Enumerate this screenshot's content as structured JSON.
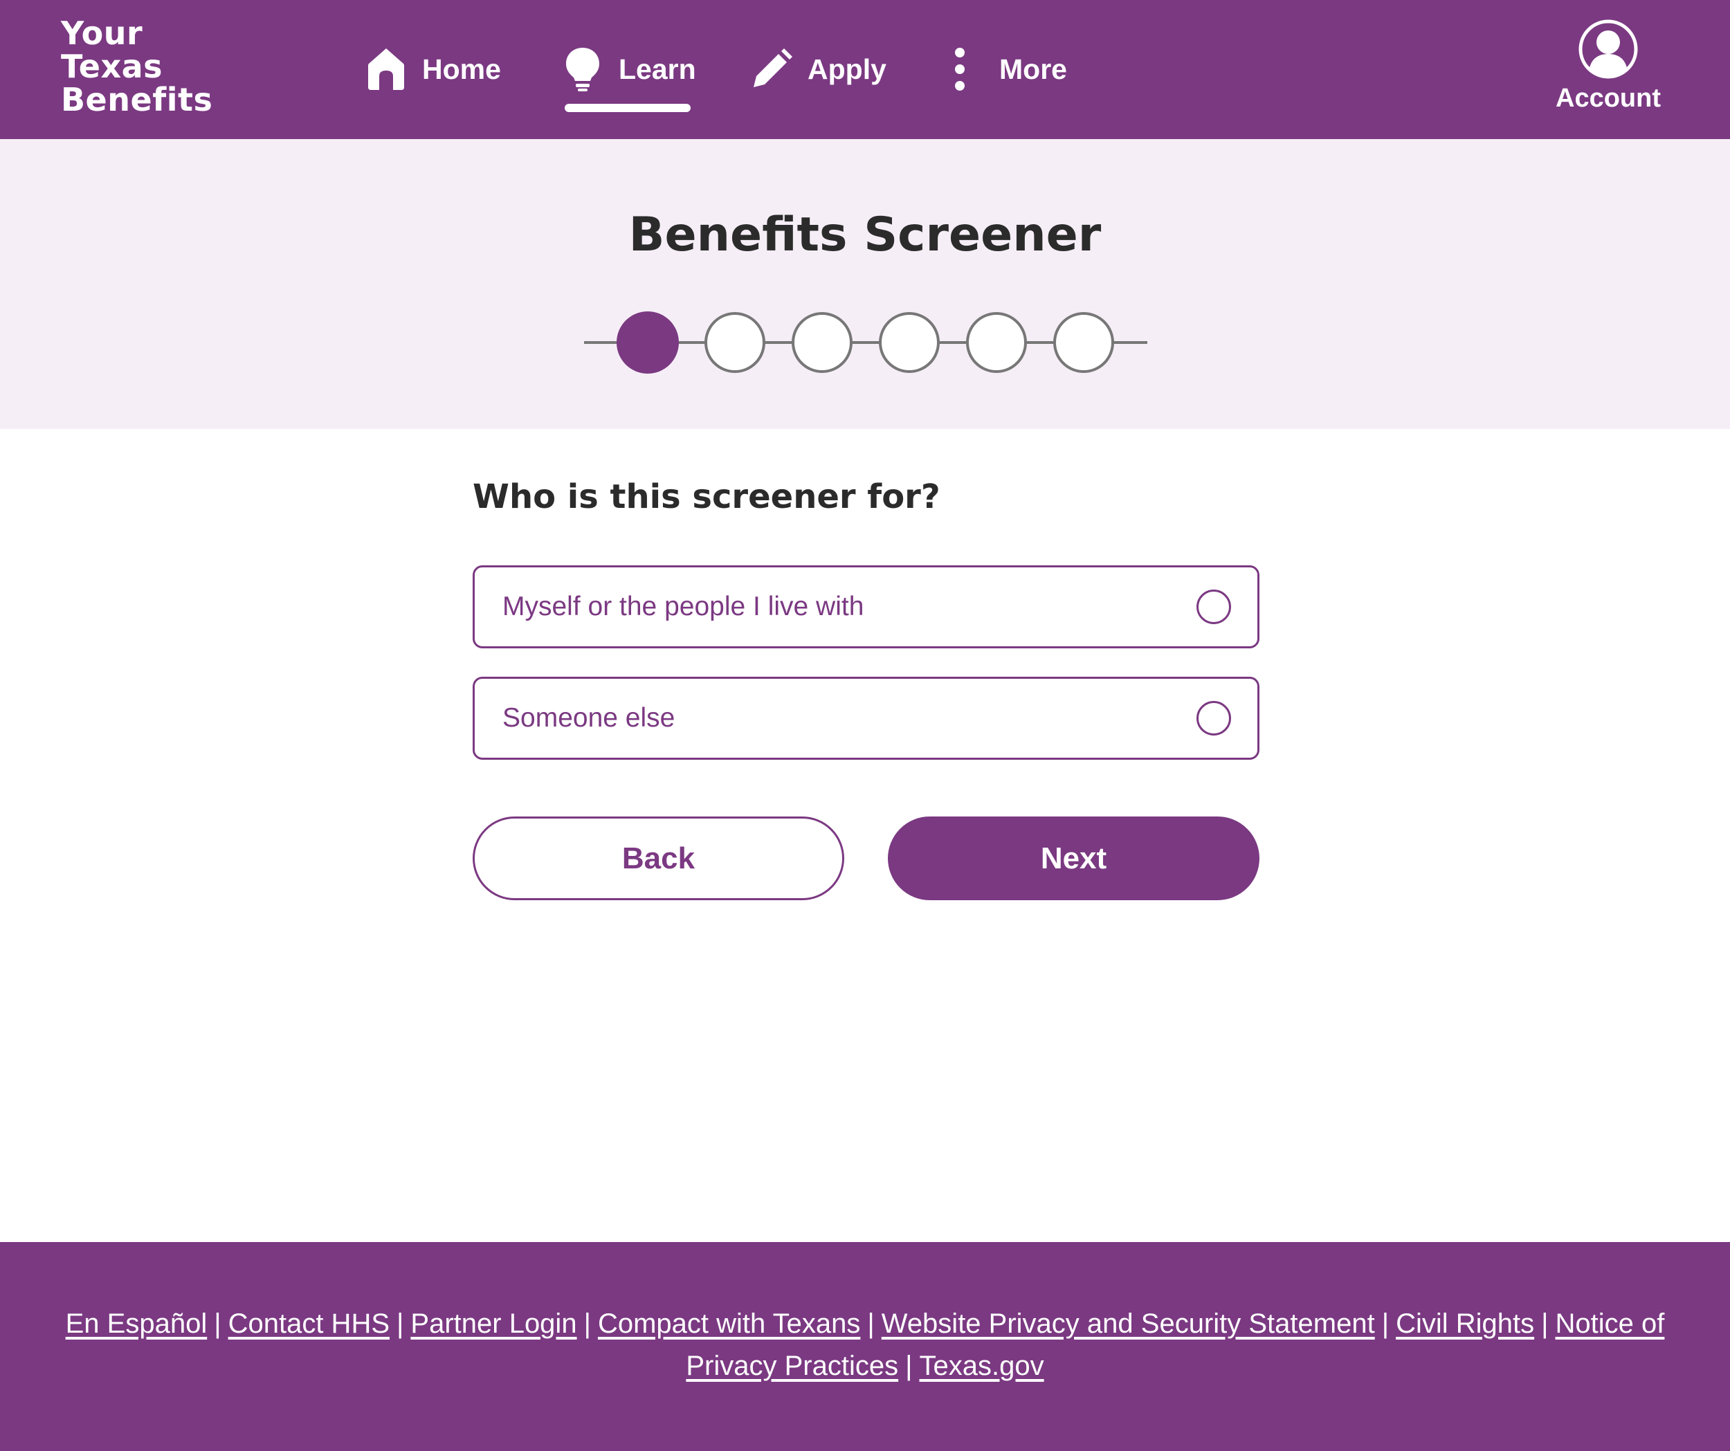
{
  "header": {
    "logo_lines": [
      "Your",
      "Texas",
      "Benefits"
    ],
    "nav": [
      {
        "label": "Home",
        "icon": "home-icon"
      },
      {
        "label": "Learn",
        "icon": "lightbulb-icon",
        "active": true
      },
      {
        "label": "Apply",
        "icon": "pencil-icon"
      },
      {
        "label": "More",
        "icon": "more-vertical-icon"
      }
    ],
    "account_label": "Account"
  },
  "hero": {
    "title": "Benefits Screener",
    "stepper": {
      "total_steps": 6,
      "current_step": 1
    }
  },
  "question": {
    "text": "Who is this screener for?",
    "options": [
      {
        "label": "Myself or the people I live with",
        "selected": false
      },
      {
        "label": "Someone else",
        "selected": false
      }
    ]
  },
  "buttons": {
    "back_label": "Back",
    "next_label": "Next"
  },
  "footer": {
    "links": [
      "En Español",
      "Contact HHS",
      "Partner Login",
      "Compact with Texans",
      "Website Privacy and Security Statement",
      "Civil Rights",
      "Notice of Privacy Practices",
      "Texas.gov"
    ],
    "separator": "|"
  },
  "colors": {
    "brand_purple": "#7b3982",
    "hero_background": "#f6eef7",
    "step_inactive_border": "#777777",
    "text_dark": "#2b2b2b"
  }
}
